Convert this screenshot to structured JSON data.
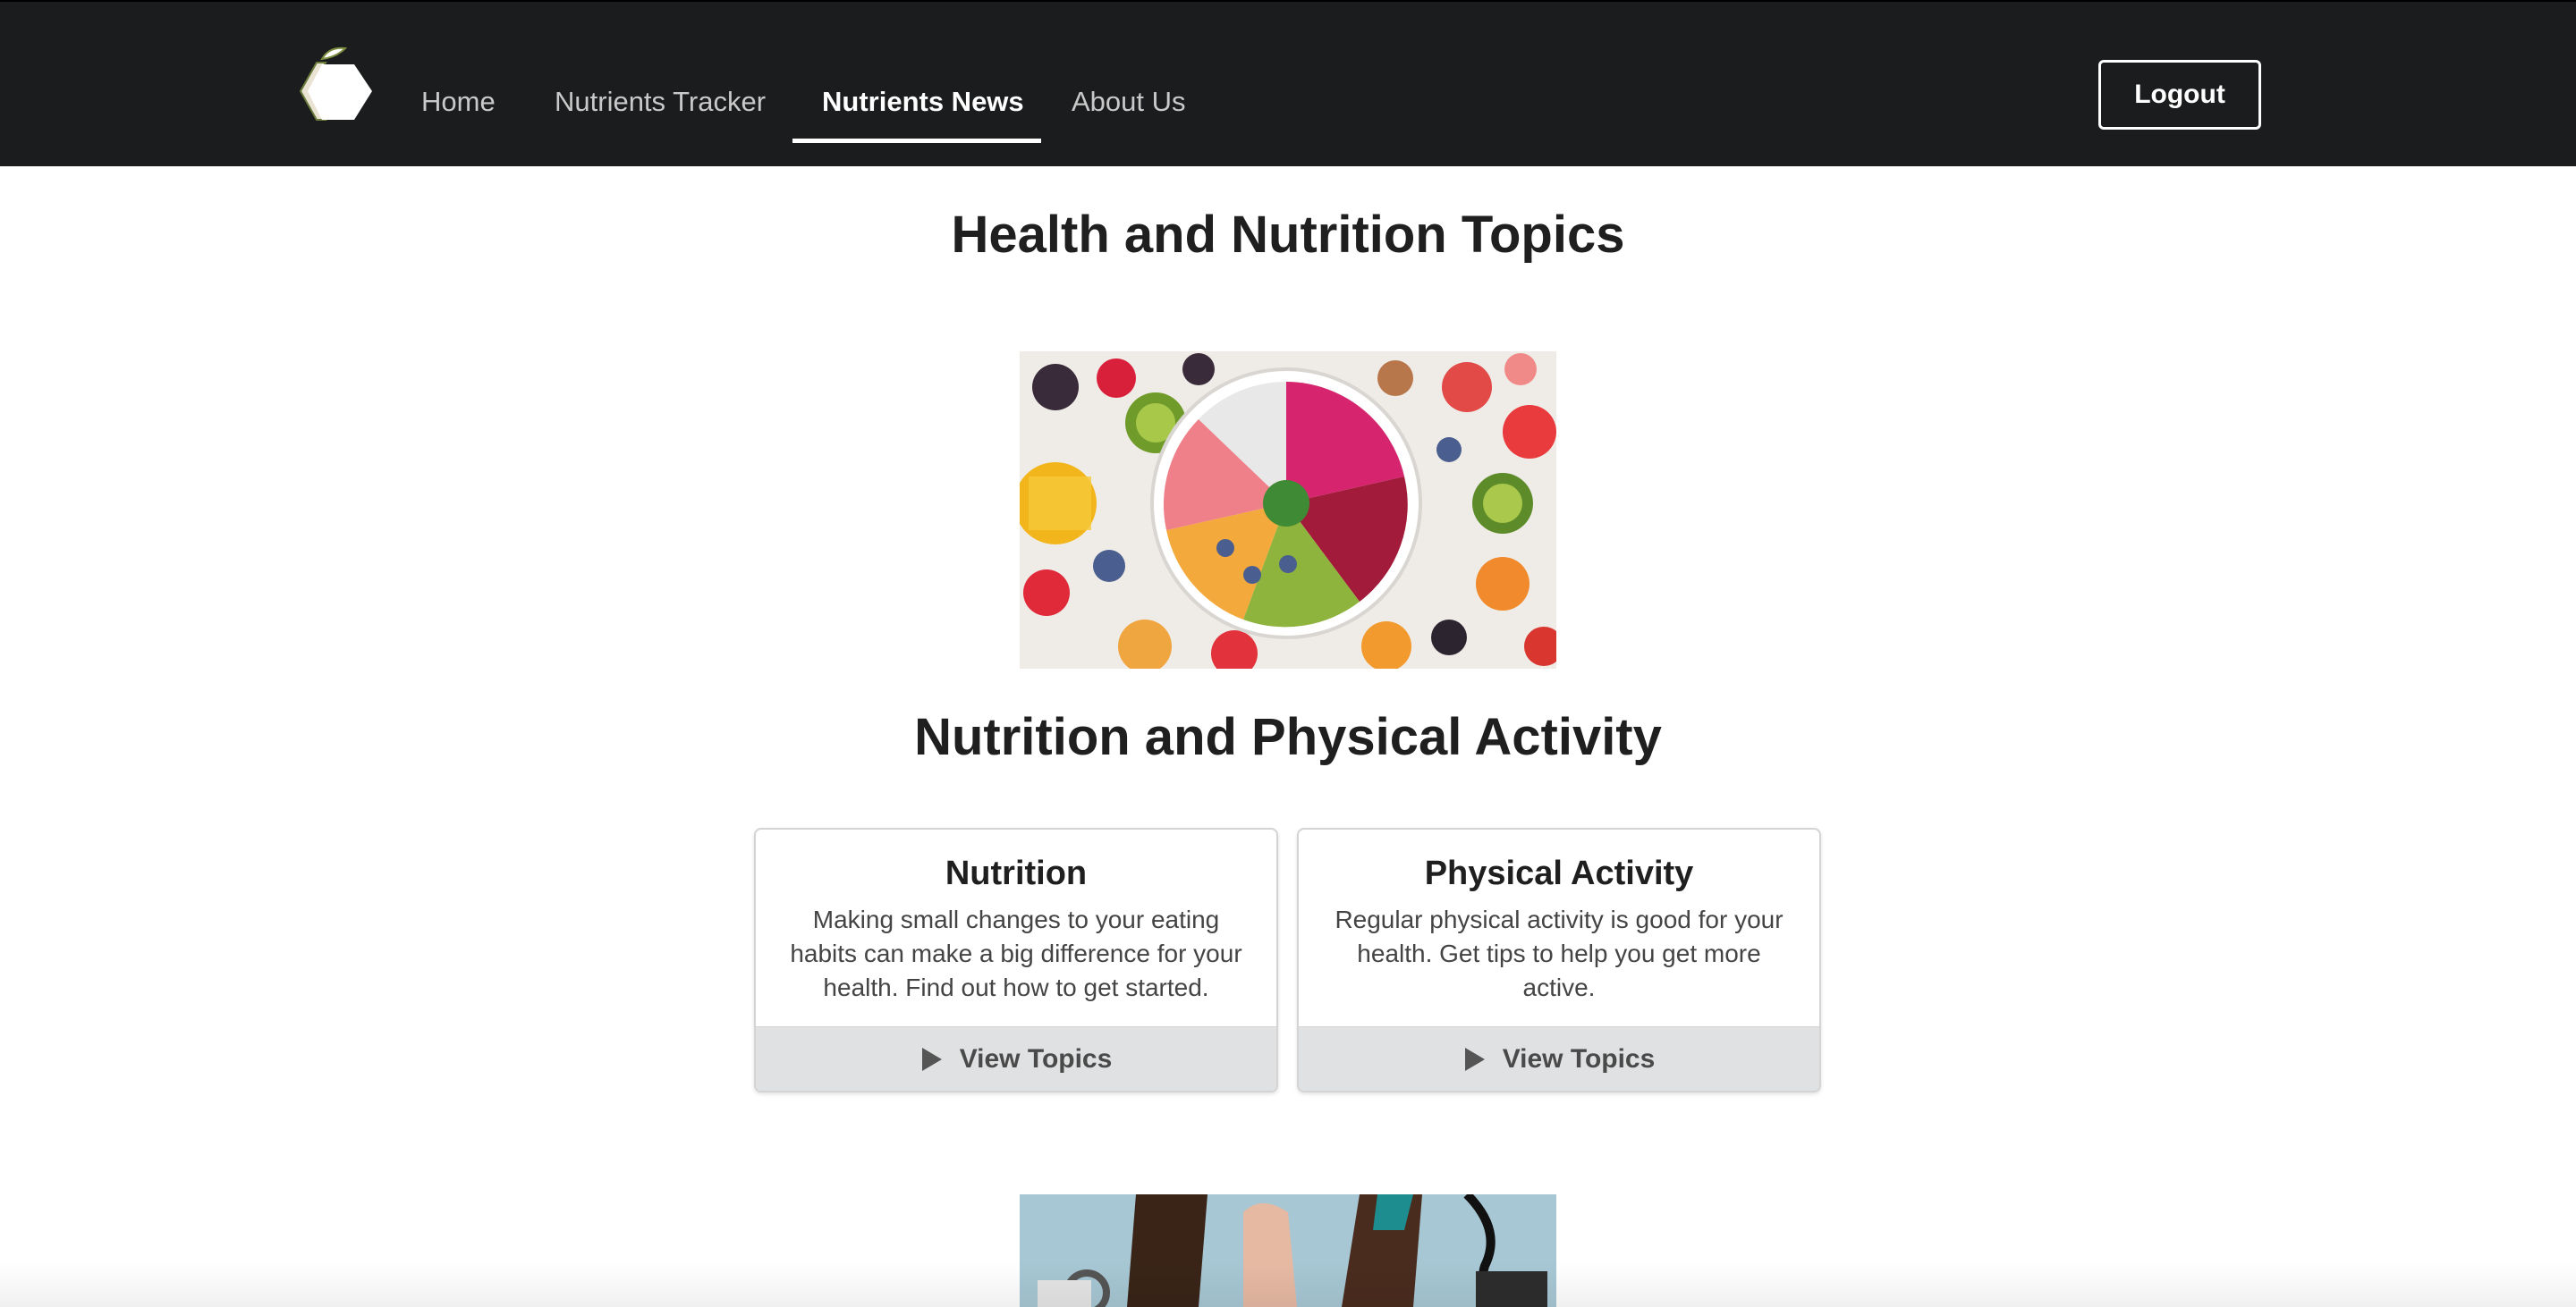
{
  "nav": {
    "items": [
      {
        "label": "Home"
      },
      {
        "label": "Nutrients Tracker"
      },
      {
        "label": "Nutrients News",
        "active": true
      },
      {
        "label": "About Us"
      }
    ],
    "logout_label": "Logout",
    "logo_icon": "hexagon-apple-logo-icon"
  },
  "main": {
    "page_title": "Health and Nutrition Topics",
    "section_title": "Nutrition and Physical Activity",
    "hero_image": "fruit-bowl-image",
    "second_image": "medical-checkup-image",
    "cards": [
      {
        "title": "Nutrition",
        "description": "Making small changes to your eating habits can make a big difference for your health. Find out how to get started.",
        "button_label": "View Topics",
        "button_icon": "play-icon"
      },
      {
        "title": "Physical Activity",
        "description": "Regular physical activity is good for your health. Get tips to help you get more active.",
        "button_label": "View Topics",
        "button_icon": "play-icon"
      }
    ]
  },
  "colors": {
    "navbar_bg": "#1b1c1d",
    "nav_text": "#c9c9c9",
    "nav_active": "#ffffff",
    "card_button_bg": "#e0e1e2",
    "heading": "#1f1f1f"
  }
}
